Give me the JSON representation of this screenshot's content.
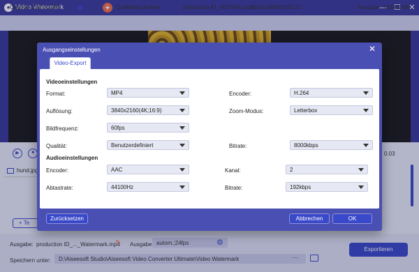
{
  "app": {
    "title": "Video Watermark"
  },
  "window_controls": {
    "min": "—",
    "max": "☐",
    "close": "✕"
  },
  "infobar": {
    "original": "Original: 1920x1080",
    "source_change": "Quelldatei ändern",
    "filename": "production ID_4927494.mp4",
    "dimensions": "1920x1080/00:00:20",
    "output": "Ausgabe: 1920x1080"
  },
  "player": {
    "timecode": "0.03"
  },
  "filelist": {
    "item": "hund.jpg"
  },
  "add_button": {
    "label": "+  Te"
  },
  "bottom": {
    "output_label": "Ausgabe:",
    "output_name": "production ID_..._Watermark.mp4",
    "format_label": "Ausgabe:",
    "format_value": "autom.;24fps",
    "save_label": "Speichern unter:",
    "save_path": "D:\\Aiseesoft Studio\\Aiseesoft Video Converter Ultimate\\Video Watermark",
    "browse": "···",
    "export": "Exportieren"
  },
  "dialog": {
    "title": "Ausgangseinstellungen",
    "close": "✕",
    "tab": "Video-Export",
    "video_section": "Videoeinstellungen",
    "audio_section": "Audioeinstellungen",
    "fields": {
      "format": {
        "label": "Format:",
        "value": "MP4"
      },
      "encoder": {
        "label": "Encoder:",
        "value": "H.264"
      },
      "resolution": {
        "label": "Auflösung:",
        "value": "3840x2160(4K;16:9)"
      },
      "zoom": {
        "label": "Zoom-Modus:",
        "value": "Letterbox"
      },
      "framerate": {
        "label": "Bildfrequenz:",
        "value": "60fps"
      },
      "quality": {
        "label": "Qualität:",
        "value": "Benutzerdefiniert"
      },
      "bitrate": {
        "label": "Bitrate:",
        "value": "8000kbps"
      },
      "a_encoder": {
        "label": "Encoder:",
        "value": "AAC"
      },
      "channel": {
        "label": "Kanal:",
        "value": "2"
      },
      "samplerate": {
        "label": "Abtastrate:",
        "value": "44100Hz"
      },
      "a_bitrate": {
        "label": "Bitrate:",
        "value": "192kbps"
      }
    },
    "reset": "Zurücksetzen",
    "cancel": "Abbrechen",
    "ok": "OK"
  },
  "colors": {
    "accent": "#3a49c9",
    "titlebar": "#3c3c9c",
    "orange": "#f26f4a"
  }
}
